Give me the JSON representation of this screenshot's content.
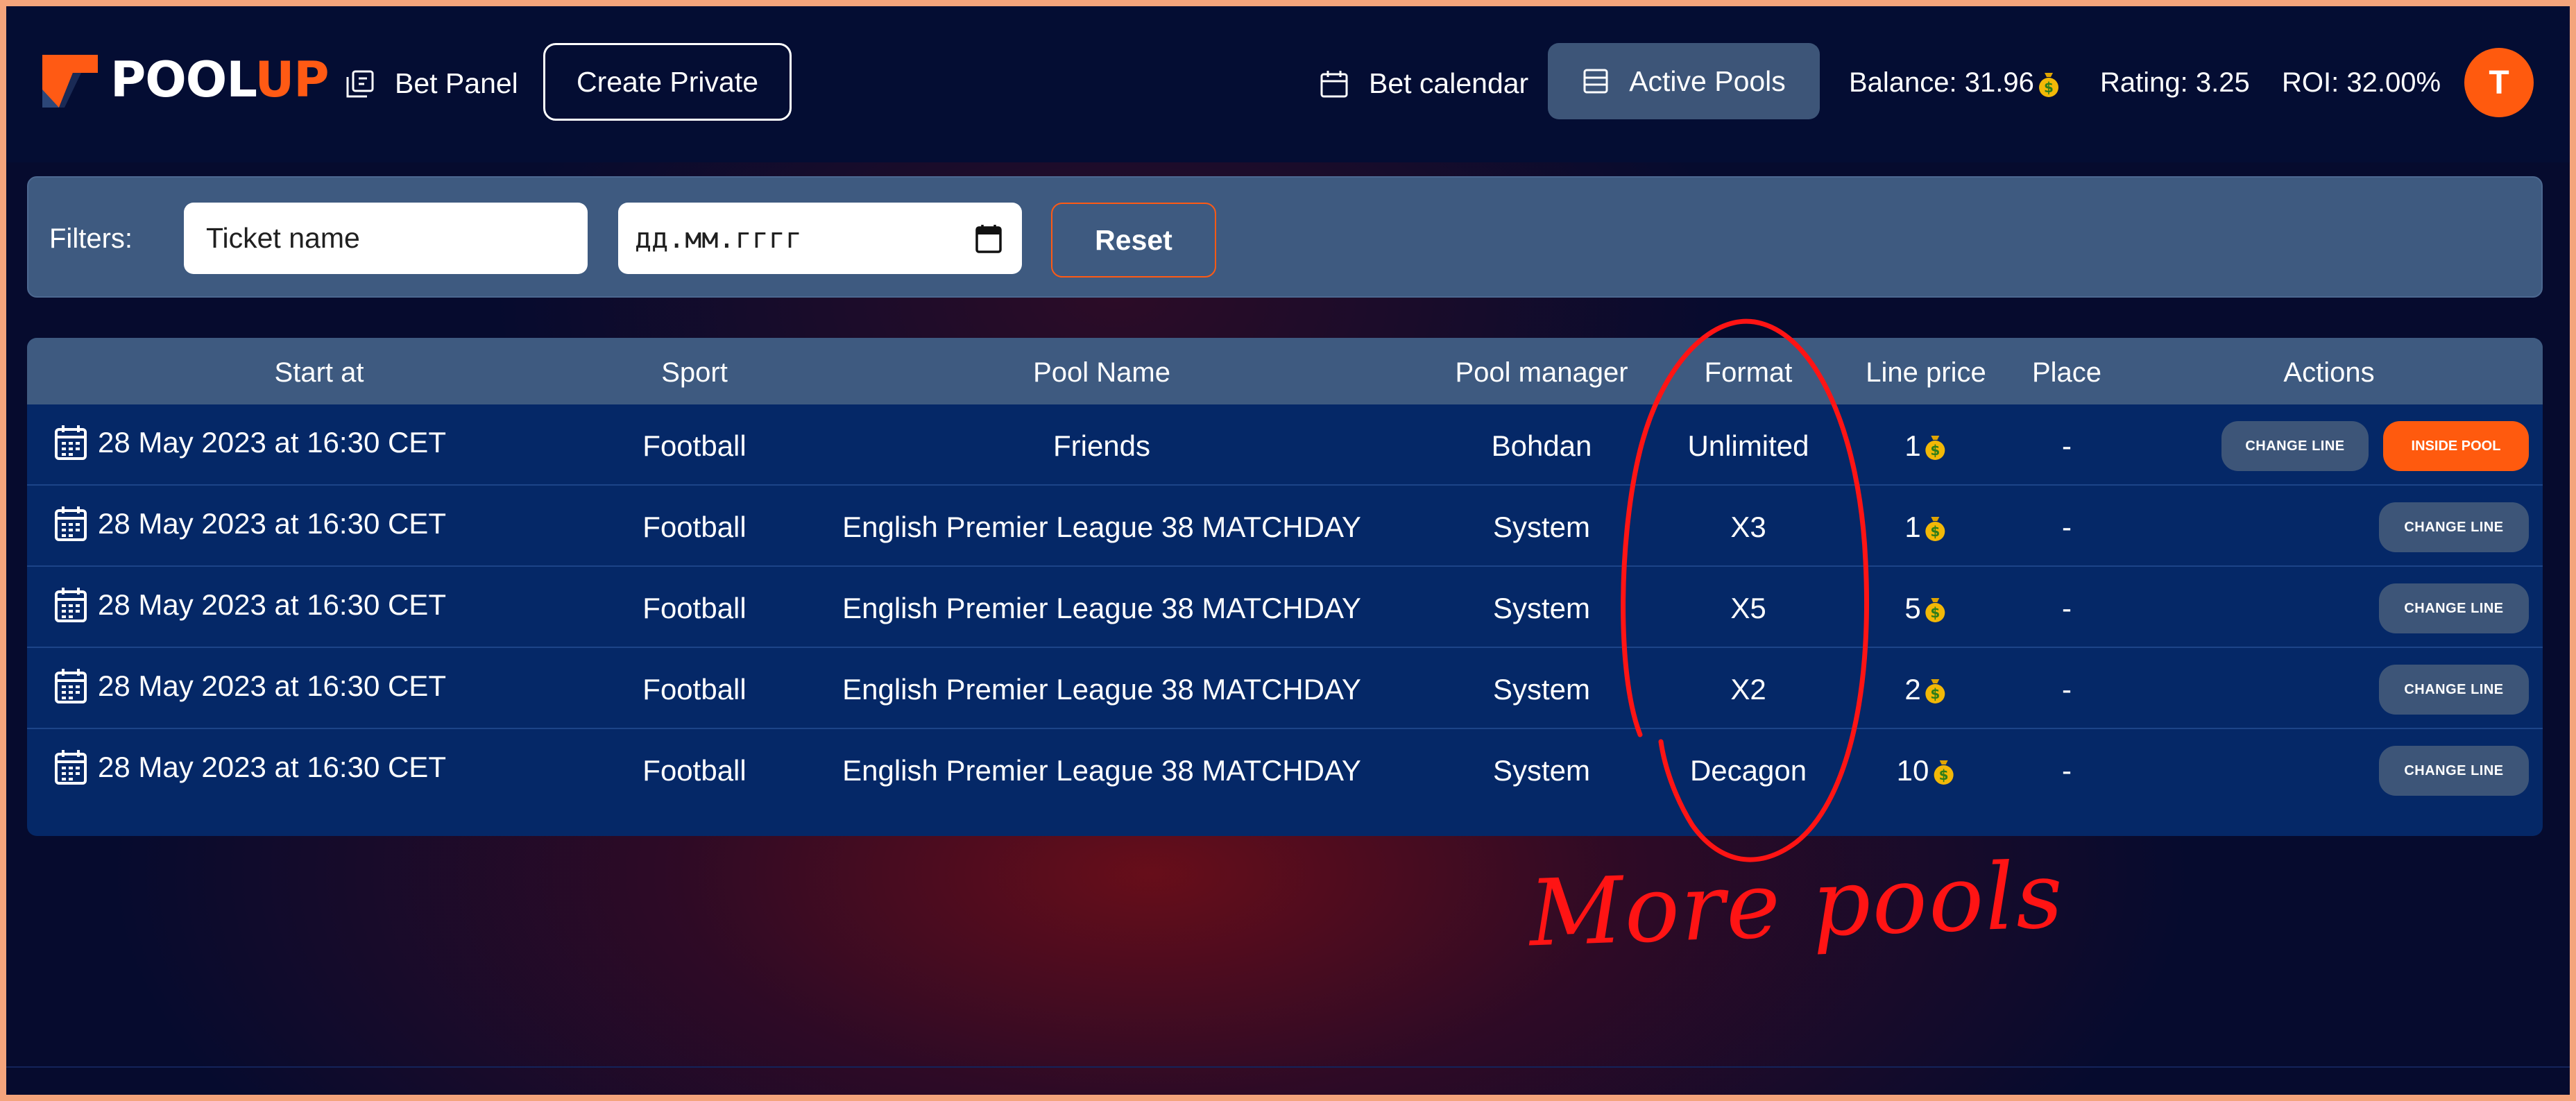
{
  "brand": {
    "part1": "POOL",
    "part2": "UP",
    "accent_color": "#ff5a14"
  },
  "nav": {
    "bet_panel": "Bet Panel",
    "create_private": "Create Private",
    "bet_calendar": "Bet calendar",
    "active_pools": "Active Pools",
    "balance": "Balance: 31.96",
    "rating": "Rating: 3.25",
    "roi": "ROI: 32.00%",
    "avatar_letter": "T"
  },
  "filters": {
    "label": "Filters:",
    "ticket_name_value": "Ticket name",
    "date_placeholder": "дд.мм.гггг",
    "reset": "Reset"
  },
  "table": {
    "headers": {
      "start": "Start at",
      "sport": "Sport",
      "pool_name": "Pool Name",
      "manager": "Pool manager",
      "format": "Format",
      "price": "Line price",
      "place": "Place",
      "actions": "Actions"
    },
    "rows": [
      {
        "start": "28 May 2023 at 16:30 CET",
        "sport": "Football",
        "pool_name": "Friends",
        "manager": "Bohdan",
        "format": "Unlimited",
        "price": "1",
        "place": "-",
        "change": "CHANGE LINE",
        "inside": "INSIDE POOL"
      },
      {
        "start": "28 May 2023 at 16:30 CET",
        "sport": "Football",
        "pool_name": "English Premier League 38 MATCHDAY",
        "manager": "System",
        "format": "X3",
        "price": "1",
        "place": "-",
        "change": "CHANGE LINE"
      },
      {
        "start": "28 May 2023 at 16:30 CET",
        "sport": "Football",
        "pool_name": "English Premier League 38 MATCHDAY",
        "manager": "System",
        "format": "X5",
        "price": "5",
        "place": "-",
        "change": "CHANGE LINE"
      },
      {
        "start": "28 May 2023 at 16:30 CET",
        "sport": "Football",
        "pool_name": "English Premier League 38 MATCHDAY",
        "manager": "System",
        "format": "X2",
        "price": "2",
        "place": "-",
        "change": "CHANGE LINE"
      },
      {
        "start": "28 May 2023 at 16:30 CET",
        "sport": "Football",
        "pool_name": "English Premier League 38 MATCHDAY",
        "manager": "System",
        "format": "Decagon",
        "price": "10",
        "place": "-",
        "change": "CHANGE LINE"
      }
    ]
  },
  "annotation": {
    "text": "More pools",
    "color": "#ff1414"
  },
  "icons": [
    "logo-mark-icon",
    "bet-panel-icon",
    "calendar-icon",
    "list-icon",
    "coin-bag-icon",
    "date-picker-icon"
  ]
}
